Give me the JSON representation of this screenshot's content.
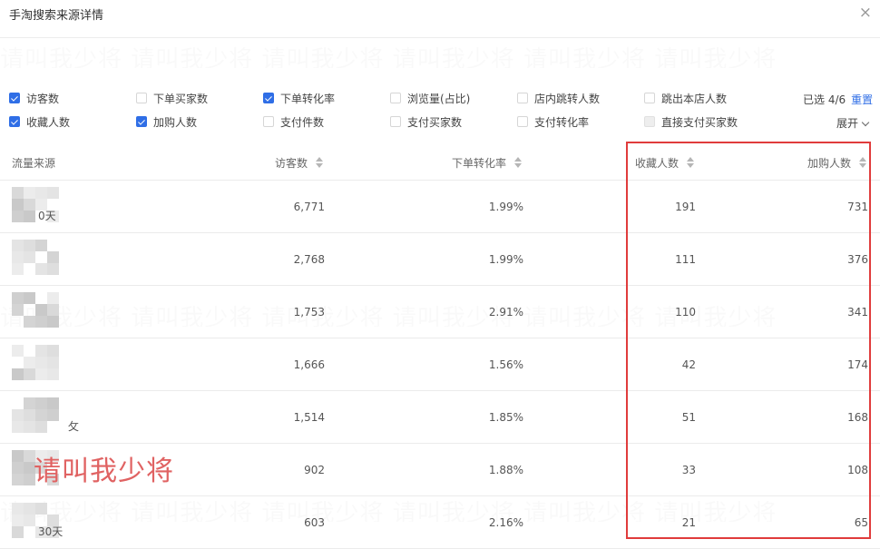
{
  "dialog": {
    "title": "手淘搜索来源详情",
    "close_glyph": "×",
    "close_icon": "close-icon"
  },
  "watermark": {
    "text": "请叫我少将 请叫我少将 请叫我少将 请叫我少将 请叫我少将 请叫我少将"
  },
  "filters": {
    "items": [
      {
        "label": "访客数",
        "checked": true,
        "disabled": false
      },
      {
        "label": "下单买家数",
        "checked": false,
        "disabled": false
      },
      {
        "label": "下单转化率",
        "checked": true,
        "disabled": false
      },
      {
        "label": "浏览量(占比)",
        "checked": false,
        "disabled": false
      },
      {
        "label": "店内跳转人数",
        "checked": false,
        "disabled": false
      },
      {
        "label": "跳出本店人数",
        "checked": false,
        "disabled": false
      },
      {
        "label": "收藏人数",
        "checked": true,
        "disabled": false
      },
      {
        "label": "加购人数",
        "checked": true,
        "disabled": false
      },
      {
        "label": "支付件数",
        "checked": false,
        "disabled": false
      },
      {
        "label": "支付买家数",
        "checked": false,
        "disabled": false
      },
      {
        "label": "支付转化率",
        "checked": false,
        "disabled": false
      },
      {
        "label": "直接支付买家数",
        "checked": false,
        "disabled": true
      }
    ],
    "selected_text": "已选 4/6",
    "reset_label": "重置",
    "expand_label": "展开",
    "expand_icon": "chevron-down-icon"
  },
  "table": {
    "columns": [
      "流量来源",
      "访客数",
      "下单转化率",
      "收藏人数",
      "加购人数"
    ],
    "rows": [
      {
        "source": "0天",
        "visitors": "6,771",
        "conv": "1.99%",
        "fav": "191",
        "cart": "731"
      },
      {
        "source": "",
        "visitors": "2,768",
        "conv": "1.99%",
        "fav": "111",
        "cart": "376"
      },
      {
        "source": "",
        "visitors": "1,753",
        "conv": "2.91%",
        "fav": "110",
        "cart": "341"
      },
      {
        "source": "",
        "visitors": "1,666",
        "conv": "1.56%",
        "fav": "42",
        "cart": "174"
      },
      {
        "source": "攵",
        "visitors": "1,514",
        "conv": "1.85%",
        "fav": "51",
        "cart": "168"
      },
      {
        "source": "",
        "visitors": "902",
        "conv": "1.88%",
        "fav": "33",
        "cart": "108"
      },
      {
        "source": "30天",
        "visitors": "603",
        "conv": "2.16%",
        "fav": "21",
        "cart": "65"
      }
    ]
  },
  "overlay": {
    "text": "请叫我少将",
    "color": "#e06262"
  },
  "highlight": {
    "color": "#e03c3c"
  },
  "colors": {
    "accent": "#2f6ee6"
  }
}
